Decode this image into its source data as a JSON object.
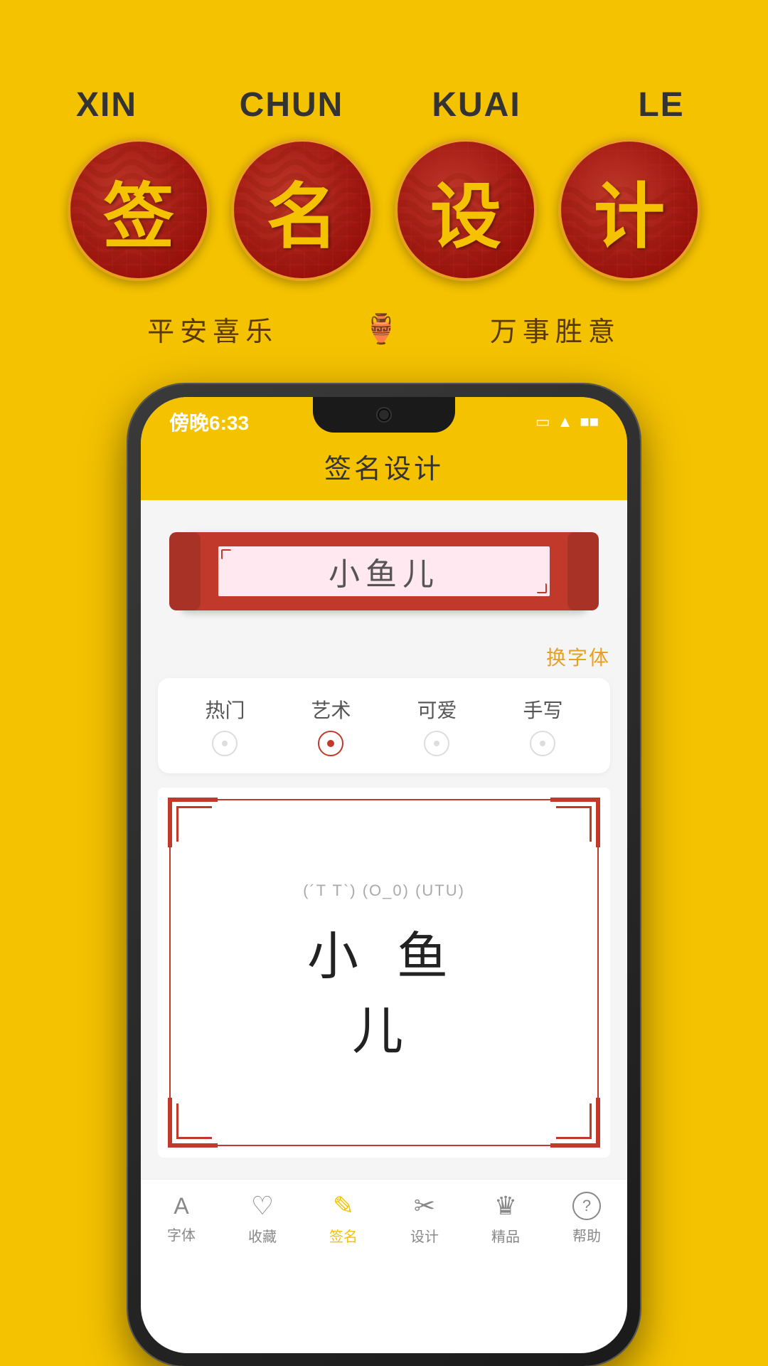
{
  "background_color": "#F5C200",
  "top_section": {
    "pinyin_labels": [
      "XIN",
      "CHUN",
      "KUAI",
      "LE"
    ],
    "chinese_chars": [
      "签",
      "名",
      "设",
      "计"
    ],
    "subtitle_left": "平安喜乐",
    "subtitle_right": "万事胜意",
    "subtitle_icon": "🏮"
  },
  "phone": {
    "status_bar": {
      "time": "傍晚6:33",
      "icons": [
        "□",
        "WiFi",
        "Battery"
      ]
    },
    "app_title": "签名设计",
    "scroll_banner": {
      "name_text": "小鱼儿"
    },
    "font_switch_label": "换字体",
    "categories": [
      {
        "label": "热门",
        "active": false
      },
      {
        "label": "艺术",
        "active": true
      },
      {
        "label": "可爱",
        "active": false
      },
      {
        "label": "手写",
        "active": false
      }
    ],
    "preview": {
      "emoticons": "(´T T`) (O_0) (UTU)",
      "name_preview": "小  鱼  儿"
    },
    "bottom_nav": [
      {
        "label": "字体",
        "icon": "A",
        "active": false
      },
      {
        "label": "收藏",
        "icon": "♡",
        "active": false
      },
      {
        "label": "签名",
        "icon": "✎",
        "active": true
      },
      {
        "label": "设计",
        "icon": "✂",
        "active": false
      },
      {
        "label": "精品",
        "icon": "♛",
        "active": false
      },
      {
        "label": "帮助",
        "icon": "?",
        "active": false
      }
    ]
  }
}
